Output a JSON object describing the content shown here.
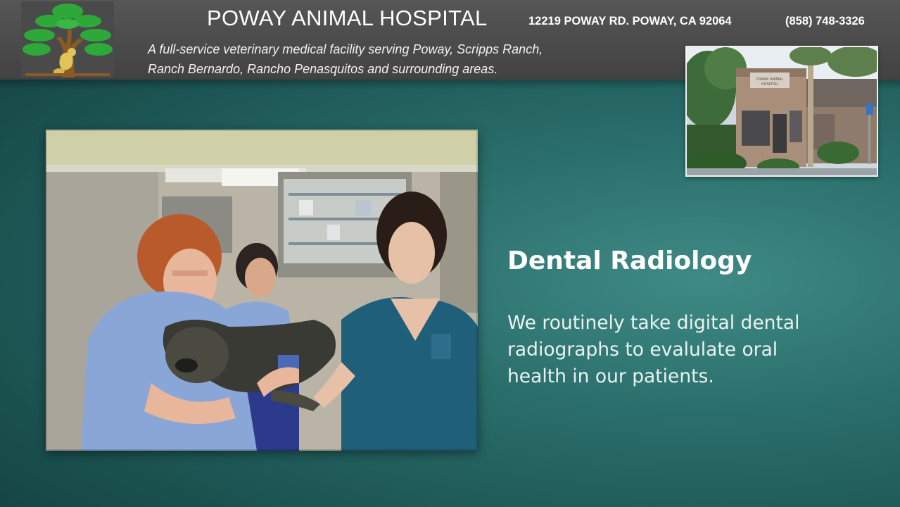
{
  "header": {
    "hospital_name": "POWAY ANIMAL HOSPITAL",
    "address": "12219 POWAY RD. POWAY, CA 92064",
    "phone": "(858) 748-3326",
    "tagline_lines": [
      "A full-service veterinary medical facility serving Poway, Scripps Ranch,",
      "Ranch Bernardo, Rancho Penasquitos  and surrounding areas."
    ]
  },
  "building_photo": {
    "sign_text": "POWAY ANIMAL HOSPITAL"
  },
  "slide": {
    "title": "Dental Radiology",
    "body_lines": [
      "We routinely take digital dental",
      "radiographs to evalulate oral",
      "health in our patients."
    ]
  },
  "colors": {
    "header_bg": "#4a4a4a",
    "slide_bg": "#2a6e6b",
    "tree_green": "#2fa83a",
    "trunk_brown": "#8a5a24",
    "scrub_blue": "#1f5f7a",
    "scrub_light": "#8aa6d6"
  },
  "icons": {
    "logo": "tree-with-animals-logo"
  }
}
